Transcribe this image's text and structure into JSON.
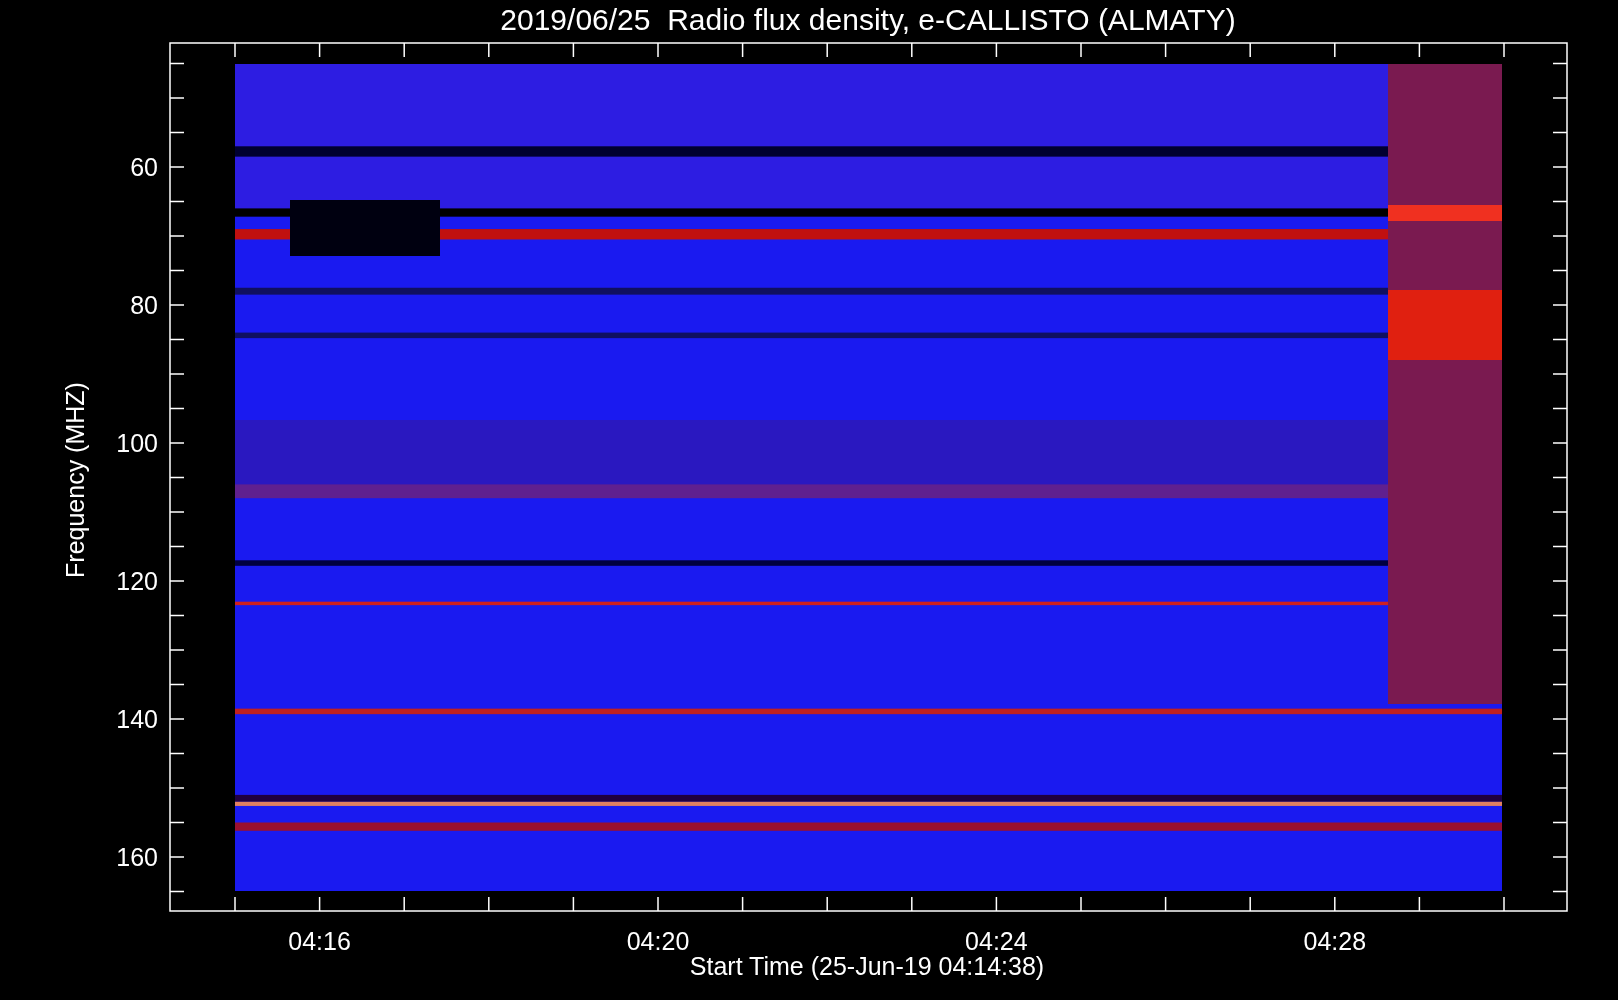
{
  "title": "2019/06/25  Radio flux density, e-CALLISTO (ALMATY)",
  "y_axis": {
    "label": "Frequency (MHZ)",
    "ticks": [
      "60",
      "80",
      "100",
      "120",
      "140",
      "160"
    ]
  },
  "x_axis": {
    "label": "Start Time (25-Jun-19 04:14:38)",
    "ticks": [
      "04:16",
      "04:20",
      "04:24",
      "04:28"
    ]
  }
}
